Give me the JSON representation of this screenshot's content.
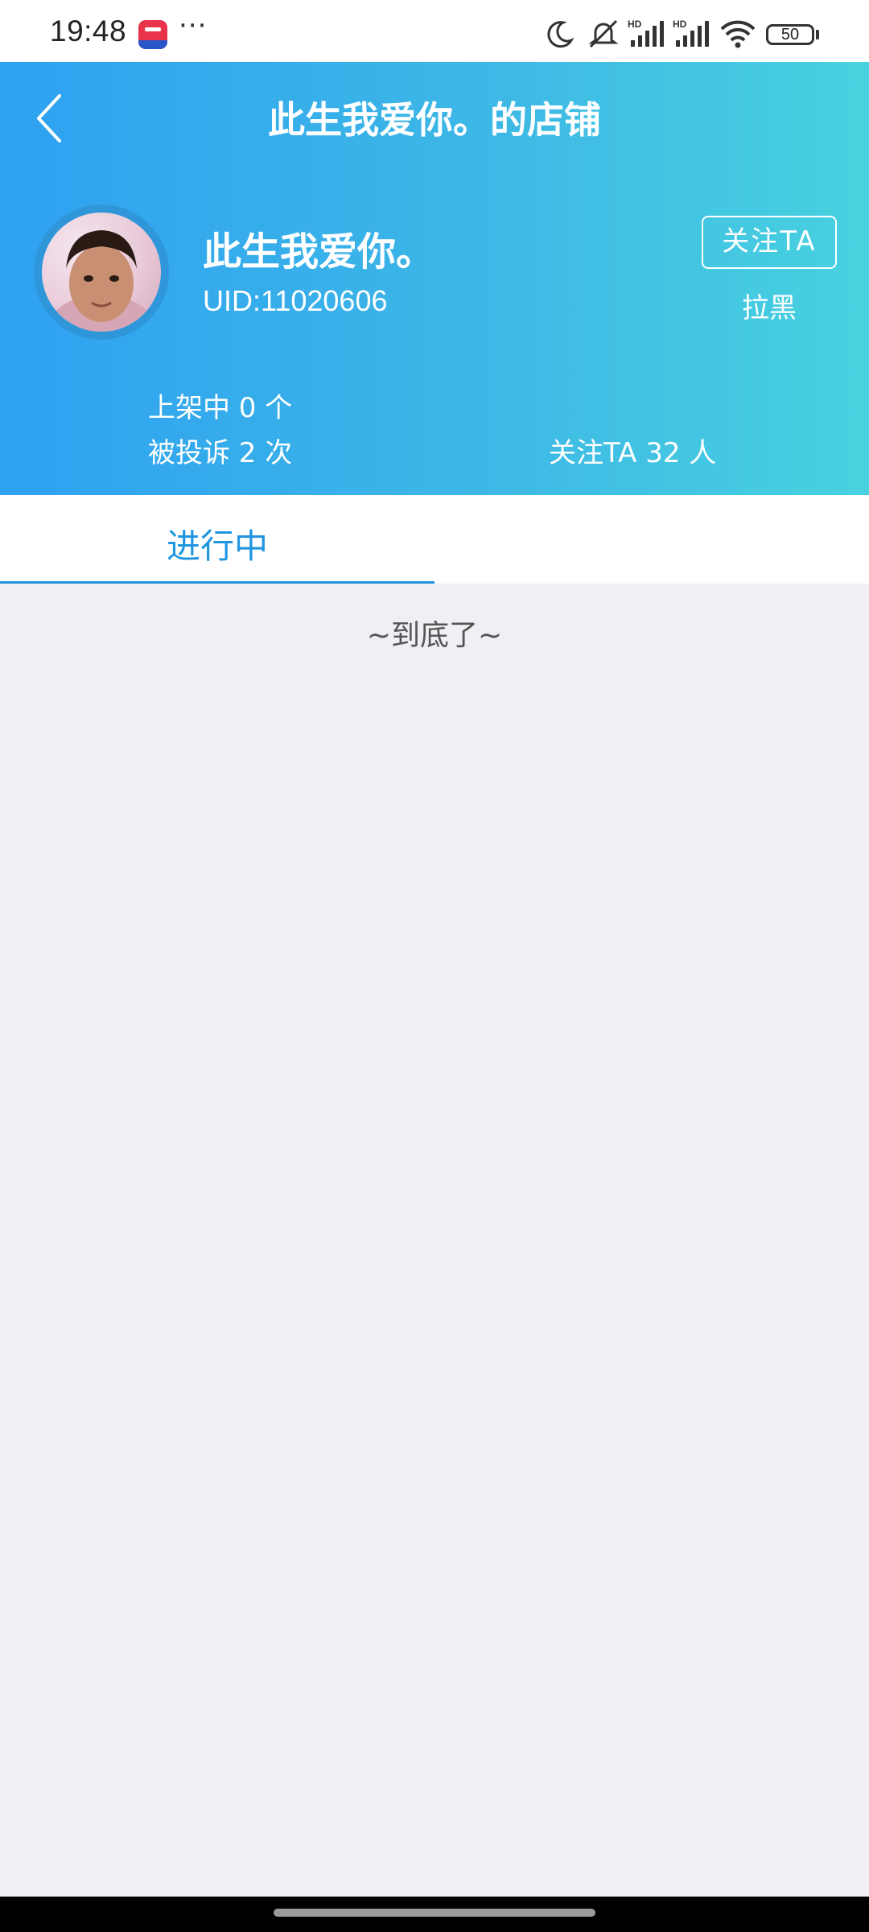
{
  "status_bar": {
    "time": "19:48",
    "more": "···",
    "battery": "50",
    "icons": [
      "moon-icon",
      "mute-icon",
      "signal-hd-icon",
      "signal-hd-icon",
      "wifi-icon",
      "battery-icon"
    ]
  },
  "header": {
    "title": "此生我爱你。的店铺",
    "shop_name": "此生我爱你。",
    "uid": "UID:11020606",
    "follow_label": "关注TA",
    "block_label": "拉黑",
    "listed": "上架中 0 个",
    "complaints": "被投诉 2 次",
    "followers": "关注TA 32 人"
  },
  "tabs": [
    {
      "label": "进行中",
      "active": true
    }
  ],
  "list": {
    "end_text": "~到底了~"
  },
  "colors": {
    "accent": "#2196e0",
    "header_gradient_start": "#2ea1f1",
    "header_gradient_end": "#48d2df",
    "background": "#efeff4"
  }
}
